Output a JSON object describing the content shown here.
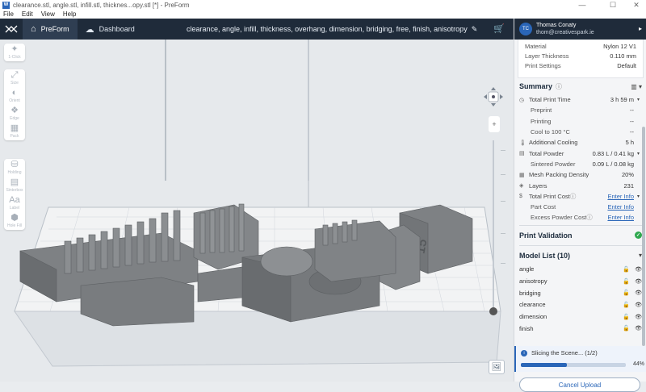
{
  "window": {
    "title": "clearance.stl, angle.stl, infill.stl, thicknes...opy.stl [*] - PreForm",
    "app_icon": "W",
    "controls": {
      "minimize": "—",
      "maximize": "☐",
      "close": "✕"
    }
  },
  "menu": [
    "File",
    "Edit",
    "View",
    "Help"
  ],
  "appbar": {
    "tabs": [
      {
        "label": "PreForm",
        "icon": "home-icon"
      },
      {
        "label": "Dashboard",
        "icon": "cloud-icon"
      }
    ],
    "job_title": "clearance, angle, infill, thickness, overhang, dimension, bridging, free, finish, anisotropy",
    "cart_icon": "cart-icon"
  },
  "toolbar": {
    "group1": [
      {
        "label": "1-Click",
        "icon": "✦"
      }
    ],
    "group2": [
      {
        "label": "Size",
        "icon": "⤢"
      },
      {
        "label": "Orient",
        "icon": "◐"
      },
      {
        "label": "Edge",
        "icon": "❖"
      },
      {
        "label": "Pack",
        "icon": "▦"
      }
    ],
    "group3": [
      {
        "label": "Holding",
        "icon": "⛁"
      },
      {
        "label": "Sinterbox",
        "icon": "▤"
      },
      {
        "label": "Label",
        "icon": "Aa"
      },
      {
        "label": "Hole Fill",
        "icon": "⬢"
      }
    ]
  },
  "scale_ticks": [
    "—",
    "—",
    "—",
    "—",
    "—"
  ],
  "user": {
    "initials": "TC",
    "name": "Thomas Conaty",
    "email": "thom@creativespark.ie"
  },
  "material": {
    "rows": [
      {
        "label": "Material",
        "value": "Nylon 12 V1"
      },
      {
        "label": "Layer Thickness",
        "value": "0.110 mm"
      },
      {
        "label": "Print Settings",
        "value": "Default"
      }
    ]
  },
  "summary": {
    "title": "Summary",
    "rows": [
      {
        "label": "Total Print Time",
        "value": "3 h 59 m",
        "icon": "◷",
        "caret": "▾",
        "sub": false,
        "link": false
      },
      {
        "label": "Preprint",
        "value": "--",
        "icon": "",
        "caret": "",
        "sub": true,
        "link": false
      },
      {
        "label": "Printing",
        "value": "--",
        "icon": "",
        "caret": "",
        "sub": true,
        "link": false
      },
      {
        "label": "Cool to 100 °C",
        "value": "--",
        "icon": "",
        "caret": "",
        "sub": true,
        "link": false
      },
      {
        "label": "Additional Cooling",
        "value": "5 h",
        "icon": "🌡",
        "caret": "",
        "sub": false,
        "link": false
      },
      {
        "label": "Total Powder",
        "value": "0.83 L / 0.41 kg",
        "icon": "▤",
        "caret": "▾",
        "sub": false,
        "link": false
      },
      {
        "label": "Sintered Powder",
        "value": "0.09 L / 0.08 kg",
        "icon": "",
        "caret": "",
        "sub": true,
        "link": false
      },
      {
        "label": "Mesh Packing Density",
        "value": "20%",
        "icon": "▦",
        "caret": "",
        "sub": false,
        "link": false
      },
      {
        "label": "Layers",
        "value": "231",
        "icon": "◈",
        "caret": "",
        "sub": false,
        "link": false
      },
      {
        "label": "Total Print Cost",
        "value": "Enter Info",
        "icon": "$",
        "caret": "▾",
        "sub": false,
        "link": true,
        "info": true
      },
      {
        "label": "Part Cost",
        "value": "Enter Info",
        "icon": "",
        "caret": "",
        "sub": true,
        "link": true
      },
      {
        "label": "Excess Powder Cost",
        "value": "Enter Info",
        "icon": "",
        "caret": "",
        "sub": true,
        "link": true,
        "info": true
      }
    ]
  },
  "validation": {
    "title": "Print Validation",
    "status_icon": "✓"
  },
  "model_list": {
    "title": "Model List (10)",
    "items": [
      "angle",
      "anisotropy",
      "bridging",
      "clearance",
      "dimension",
      "finish"
    ]
  },
  "slicing": {
    "label": "Slicing the Scene... (1/2)",
    "percent_text": "44%",
    "progress": 0.44
  },
  "cancel_label": "Cancel Upload",
  "colors": {
    "accent": "#2a66b8",
    "appbar": "#1f2b3a",
    "part_gray": "#7d7f82",
    "success": "#2fa84f"
  }
}
